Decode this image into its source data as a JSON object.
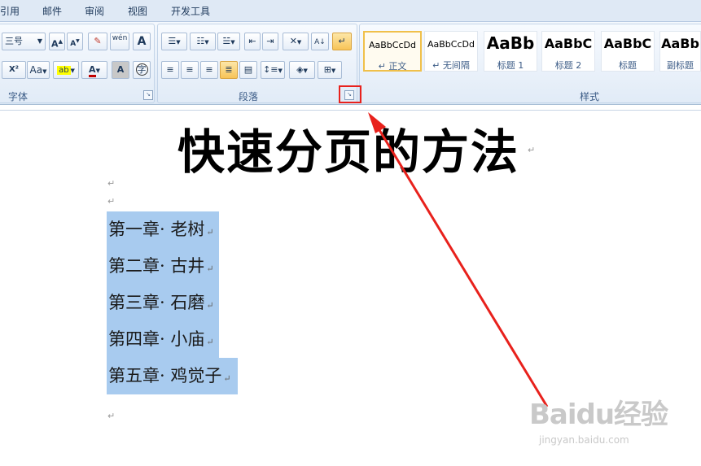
{
  "tabs": [
    "引用",
    "邮件",
    "审阅",
    "视图",
    "开发工具"
  ],
  "groups": {
    "font": "字体",
    "paragraph": "段落",
    "styles": "样式"
  },
  "font": {
    "size": "三号",
    "aa_label": "Aa",
    "x2": "X²",
    "color_a": "A",
    "boxed_a": "A",
    "circle_char": "字",
    "grow": "A",
    "shrink": "A",
    "wen": "wén"
  },
  "styles": [
    {
      "sample": "AaBbCcDd",
      "name": "↵ 正文"
    },
    {
      "sample": "AaBbCcDd",
      "name": "↵ 无间隔"
    },
    {
      "sample": "AaBb",
      "name": "标题 1"
    },
    {
      "sample": "AaBbC",
      "name": "标题 2"
    },
    {
      "sample": "AaBbC",
      "name": "标题"
    },
    {
      "sample": "AaBb",
      "name": "副标题"
    }
  ],
  "document": {
    "title": "快速分页的方法",
    "paragraph_mark": "↵",
    "chapters": [
      "第一章· 老树",
      "第二章· 古井",
      "第三章· 石磨",
      "第四章· 小庙",
      "第五章· 鸡觉子"
    ]
  },
  "watermark": {
    "brand": "Baidu经验",
    "url": "jingyan.baidu.com"
  },
  "colors": {
    "highlight": "#a8cbef",
    "annotation": "#e8211c",
    "font_color": "#c00000"
  }
}
